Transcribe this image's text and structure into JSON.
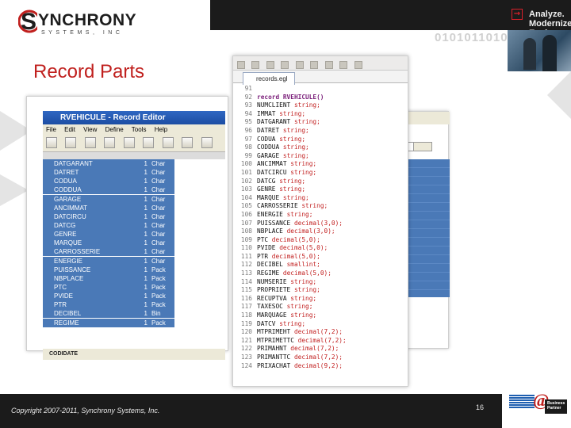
{
  "header": {
    "brand_name": "YNCHRONY",
    "brand_sub": "SYSTEMS, INC",
    "tagline": "Analyze. Modernize. Evolve.",
    "binary": "0101011010"
  },
  "slide": {
    "title": "Record Parts",
    "copyright": "Copyright 2007-2011, Synchrony Systems, Inc.",
    "page_number": "16"
  },
  "record_editor": {
    "window_title": "RVEHICULE - Record Editor",
    "menu": [
      "File",
      "Edit",
      "View",
      "Define",
      "Tools",
      "Help"
    ],
    "rows": [
      {
        "name": "DATGARANT",
        "dim": "1",
        "type": "Char"
      },
      {
        "name": "DATRET",
        "dim": "1",
        "type": "Char"
      },
      {
        "name": "CODUA",
        "dim": "1",
        "type": "Char"
      },
      {
        "name": "CODDUA",
        "dim": "1",
        "type": "Char"
      },
      {
        "name": "GARAGE",
        "dim": "1",
        "type": "Char"
      },
      {
        "name": "ANCIMMAT",
        "dim": "1",
        "type": "Char"
      },
      {
        "name": "DATCIRCU",
        "dim": "1",
        "type": "Char"
      },
      {
        "name": "DATCG",
        "dim": "1",
        "type": "Char"
      },
      {
        "name": "GENRE",
        "dim": "1",
        "type": "Char"
      },
      {
        "name": "MARQUE",
        "dim": "1",
        "type": "Char"
      },
      {
        "name": "CARROSSERIE",
        "dim": "1",
        "type": "Char"
      },
      {
        "name": "ENERGIE",
        "dim": "1",
        "type": "Char"
      },
      {
        "name": "PUISSANCE",
        "dim": "1",
        "type": "Pack"
      },
      {
        "name": "NBPLACE",
        "dim": "1",
        "type": "Pack"
      },
      {
        "name": "PTC",
        "dim": "1",
        "type": "Pack"
      },
      {
        "name": "PVIDE",
        "dim": "1",
        "type": "Pack"
      },
      {
        "name": "PTR",
        "dim": "1",
        "type": "Pack"
      },
      {
        "name": "DECIBEL",
        "dim": "1",
        "type": "Bin"
      },
      {
        "name": "REGIME",
        "dim": "1",
        "type": "Pack"
      }
    ],
    "bottom_label": "CODIDATE"
  },
  "code_editor": {
    "tab_label": "records.egl",
    "lines": [
      {
        "num": "91",
        "field": "",
        "type": ""
      },
      {
        "num": "92",
        "field": "record RVEHICULE()",
        "type": "",
        "kw": true
      },
      {
        "num": "93",
        "field": "NUMCLIENT",
        "type": "string;"
      },
      {
        "num": "94",
        "field": "IMMAT",
        "type": "string;"
      },
      {
        "num": "95",
        "field": "DATGARANT",
        "type": "string;"
      },
      {
        "num": "96",
        "field": "DATRET",
        "type": "string;"
      },
      {
        "num": "97",
        "field": "CODUA",
        "type": "string;"
      },
      {
        "num": "98",
        "field": "CODDUA",
        "type": "string;"
      },
      {
        "num": "99",
        "field": "GARAGE",
        "type": "string;"
      },
      {
        "num": "100",
        "field": "ANCIMMAT",
        "type": "string;"
      },
      {
        "num": "101",
        "field": "DATCIRCU",
        "type": "string;"
      },
      {
        "num": "102",
        "field": "DATCG",
        "type": "string;"
      },
      {
        "num": "103",
        "field": "GENRE",
        "type": "string;"
      },
      {
        "num": "104",
        "field": "MARQUE",
        "type": "string;"
      },
      {
        "num": "105",
        "field": "CARROSSERIE",
        "type": "string;"
      },
      {
        "num": "106",
        "field": "ENERGIE",
        "type": "string;"
      },
      {
        "num": "107",
        "field": "PUISSANCE",
        "type": "decimal(3,0);"
      },
      {
        "num": "108",
        "field": "NBPLACE",
        "type": "decimal(3,0);"
      },
      {
        "num": "109",
        "field": "PTC",
        "type": "decimal(5,0);"
      },
      {
        "num": "110",
        "field": "PVIDE",
        "type": "decimal(5,0);"
      },
      {
        "num": "111",
        "field": "PTR",
        "type": "decimal(5,0);"
      },
      {
        "num": "112",
        "field": "DECIBEL",
        "type": "smallint;"
      },
      {
        "num": "113",
        "field": "REGIME",
        "type": "decimal(5,0);"
      },
      {
        "num": "114",
        "field": "NUMSERIE",
        "type": "string;"
      },
      {
        "num": "115",
        "field": "PROPRIETE",
        "type": "string;"
      },
      {
        "num": "116",
        "field": "RECUPTVA",
        "type": "string;"
      },
      {
        "num": "117",
        "field": "TAXESOC",
        "type": "string;"
      },
      {
        "num": "118",
        "field": "MARQUAGE",
        "type": "string;"
      },
      {
        "num": "119",
        "field": "DATCV",
        "type": "string;"
      },
      {
        "num": "120",
        "field": "MTPRIMEHT",
        "type": "decimal(7,2);"
      },
      {
        "num": "121",
        "field": "MTPRIMETTC",
        "type": "decimal(7,2);"
      },
      {
        "num": "122",
        "field": "PRIMAHNT",
        "type": "decimal(7,2);"
      },
      {
        "num": "123",
        "field": "PRIMANTTC",
        "type": "decimal(7,2);"
      },
      {
        "num": "124",
        "field": "PRIXACHAT",
        "type": "decimal(9,2);"
      }
    ]
  },
  "partner": {
    "brand": "IBM",
    "at": "@",
    "label": "Business Partner"
  },
  "colors": {
    "accent_red": "#c0201e",
    "dark_bar": "#1b1b1b",
    "grid_blue": "#4a79b7"
  }
}
